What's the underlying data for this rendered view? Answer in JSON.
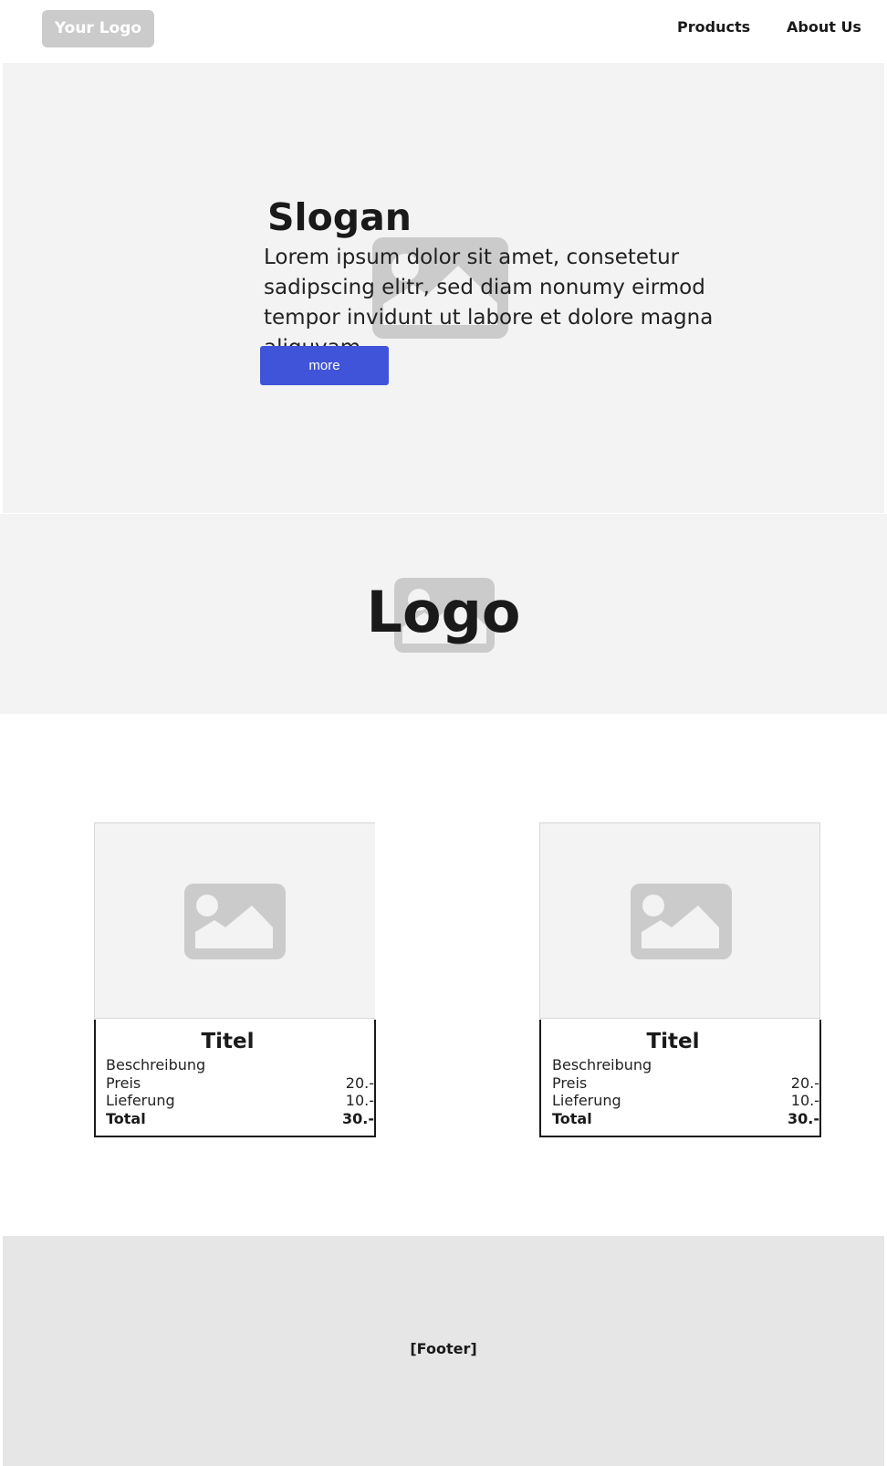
{
  "header": {
    "logo_label": "Your Logo",
    "nav": [
      {
        "label": "Products"
      },
      {
        "label": "About Us"
      }
    ]
  },
  "hero": {
    "slogan": "Slogan",
    "text": "Lorem ipsum dolor sit amet, consetetur sadipscing elitr, sed diam nonumy eirmod tempor invidunt ut labore et dolore magna aliquyam",
    "button_label": "more",
    "image_icon": "image-placeholder-icon"
  },
  "logo_band": {
    "label": "Logo",
    "image_icon": "image-placeholder-icon"
  },
  "products": [
    {
      "title": "Titel",
      "description": "Beschreibung",
      "price_label": "Preis",
      "price_value": "20.-",
      "delivery_label": "Lieferung",
      "delivery_value": "10.-",
      "total_label": "Total",
      "total_value": "30.-",
      "image_icon": "image-placeholder-icon"
    },
    {
      "title": "Titel",
      "description": "Beschreibung",
      "price_label": "Preis",
      "price_value": "20.-",
      "delivery_label": "Lieferung",
      "delivery_value": "10.-",
      "total_label": "Total",
      "total_value": "30.-",
      "image_icon": "image-placeholder-icon"
    }
  ],
  "footer": {
    "label": "[Footer]"
  },
  "colors": {
    "accent": "#4054d9",
    "placeholder": "#cbcbcb",
    "section_bg": "#f3f3f3",
    "footer_bg": "#e6e6e6"
  }
}
